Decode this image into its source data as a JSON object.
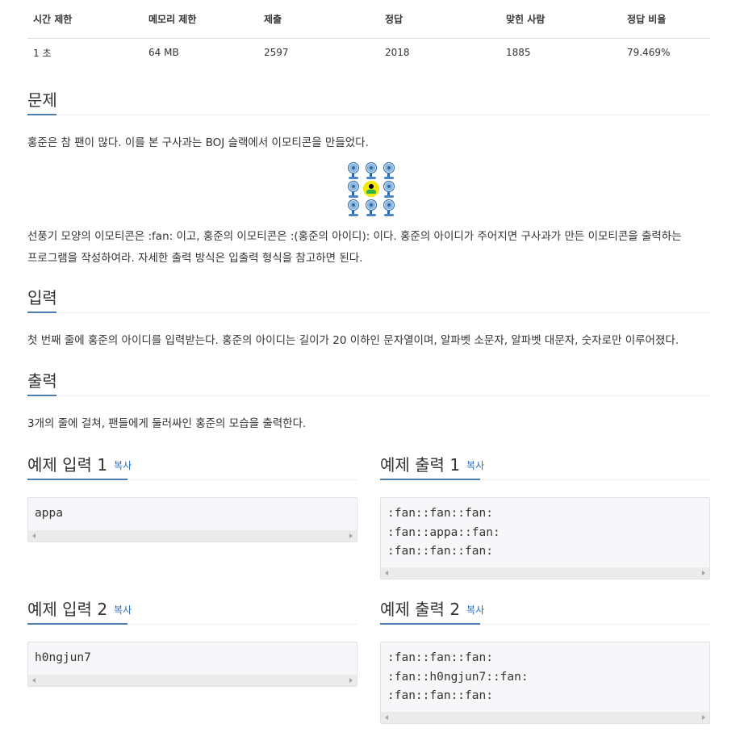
{
  "stats": {
    "headers": [
      "시간 제한",
      "메모리 제한",
      "제출",
      "정답",
      "맞힌 사람",
      "정답 비율"
    ],
    "values": [
      "1 초",
      "64 MB",
      "2597",
      "2018",
      "1885",
      "79.469%"
    ]
  },
  "problem": {
    "title": "문제",
    "intro": "홍준은 참 팬이 많다. 이를 본 구사과는 BOJ 슬랙에서 이모티콘을 만들었다.",
    "emoji_grid": [
      "fan",
      "fan",
      "fan",
      "fan",
      "face",
      "fan",
      "fan",
      "fan",
      "fan"
    ],
    "body_line1": "선풍기 모양의 이모티콘은 :fan: 이고, 홍준의 이모티콘은 :(홍준의 아이디): 이다. 홍준의 아이디가 주어지면 구사과가 만든 이모티콘을 출력하는",
    "body_line2": "프로그램을 작성하여라. 자세한 출력 방식은 입출력 형식을 참고하면 된다."
  },
  "input": {
    "title": "입력",
    "text": "첫 번째 줄에 홍준의 아이디를 입력받는다. 홍준의 아이디는 길이가 20 이하인 문자열이며, 알파벳 소문자, 알파벳 대문자, 숫자로만 이루어졌다."
  },
  "output": {
    "title": "출력",
    "text": "3개의 줄에 걸쳐, 팬들에게 둘러싸인 홍준의 모습을 출력한다."
  },
  "samples": [
    {
      "title": "예제 입력 1",
      "copy": "복사",
      "code": "appa"
    },
    {
      "title": "예제 출력 1",
      "copy": "복사",
      "code": ":fan::fan::fan:\n:fan::appa::fan:\n:fan::fan::fan:"
    },
    {
      "title": "예제 입력 2",
      "copy": "복사",
      "code": "h0ngjun7"
    },
    {
      "title": "예제 출력 2",
      "copy": "복사",
      "code": ":fan::fan::fan:\n:fan::h0ngjun7::fan:\n:fan::fan::fan:"
    }
  ]
}
